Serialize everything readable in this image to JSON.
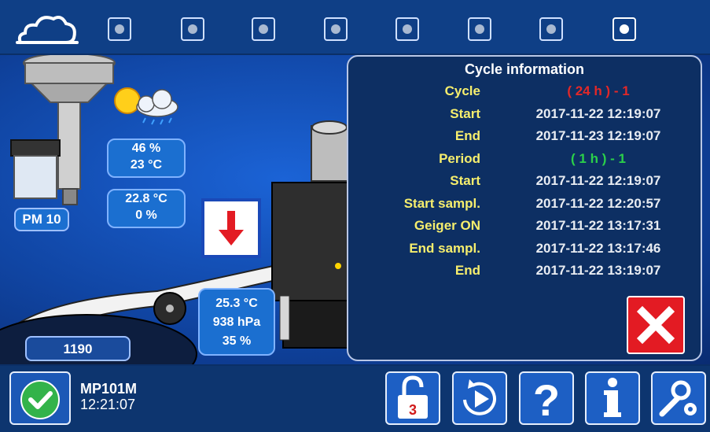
{
  "topbar": {
    "logo_icon": "cloud-icon",
    "tabs": [
      {
        "state": "inactive"
      },
      {
        "state": "inactive"
      },
      {
        "state": "inactive"
      },
      {
        "state": "inactive"
      },
      {
        "state": "inactive"
      },
      {
        "state": "inactive"
      },
      {
        "state": "inactive"
      },
      {
        "state": "active"
      }
    ]
  },
  "sensors": {
    "weather": {
      "humidity": "46 %",
      "temp": "23 °C"
    },
    "sample": {
      "temp": "22.8 °C",
      "rh": "0 %"
    },
    "pm_label": "PM 10",
    "ambient": {
      "temp": "25.3 °C",
      "pressure": "938 hPa",
      "rh": "35 %"
    },
    "counter": "1190"
  },
  "cycle_info": {
    "title": "Cycle information",
    "rows": [
      {
        "label": "Cycle",
        "value": "( 24 h ) - 1",
        "color": "#e32828"
      },
      {
        "label": "Start",
        "value": "2017-11-22 12:19:07"
      },
      {
        "label": "End",
        "value": "2017-11-23 12:19:07"
      },
      {
        "label": "Period",
        "value": "( 1 h ) - 1",
        "color": "#2bd04a"
      },
      {
        "label": "Start",
        "value": "2017-11-22 12:19:07"
      },
      {
        "label": "Start sampl.",
        "value": "2017-11-22 12:20:57"
      },
      {
        "label": "Geiger ON",
        "value": "2017-11-22 13:17:31"
      },
      {
        "label": "End sampl.",
        "value": "2017-11-22 13:17:46"
      },
      {
        "label": "End",
        "value": "2017-11-22 13:19:07"
      }
    ]
  },
  "status": {
    "device": "MP101M",
    "time": "12:21:07",
    "lock_number": "3"
  },
  "colors": {
    "accent": "#1d5fc4",
    "label_yellow": "#f6ee6d",
    "close_red": "#e31b23",
    "ok_green": "#33b34a"
  }
}
